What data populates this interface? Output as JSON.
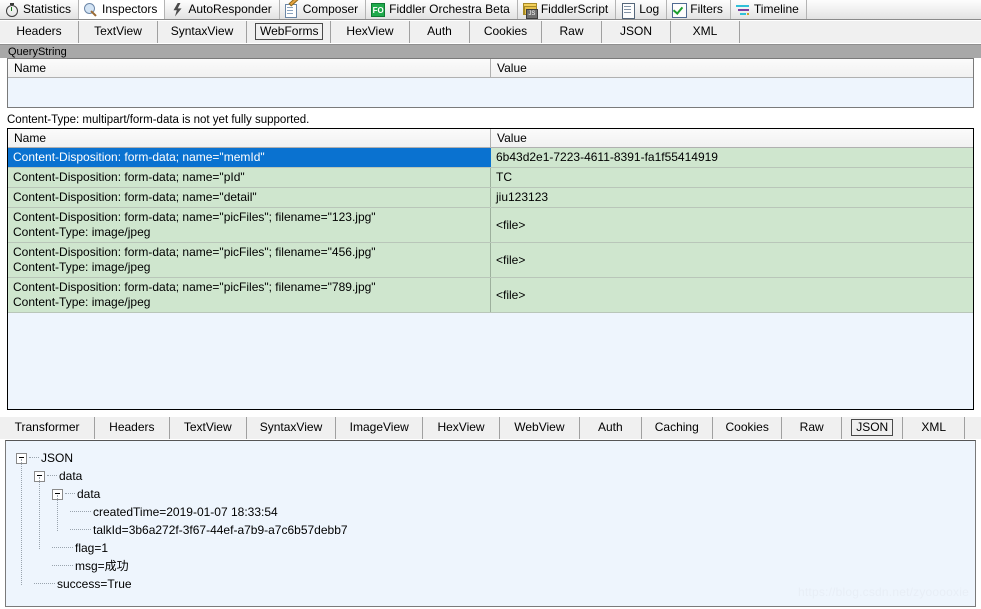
{
  "main_tabs": [
    {
      "label": "Statistics",
      "icon": "stopwatch-icon",
      "active": false
    },
    {
      "label": "Inspectors",
      "icon": "magnifier-icon",
      "active": true
    },
    {
      "label": "AutoResponder",
      "icon": "lightning-bolt-icon",
      "active": false
    },
    {
      "label": "Composer",
      "icon": "composer-pencil-icon",
      "active": false
    },
    {
      "label": "Fiddler Orchestra Beta",
      "icon": "fiddler-orchestra-badge-icon",
      "active": false
    },
    {
      "label": "FiddlerScript",
      "icon": "script-stack-icon",
      "active": false
    },
    {
      "label": "Log",
      "icon": "log-document-icon",
      "active": false
    },
    {
      "label": "Filters",
      "icon": "checkbox-check-icon",
      "active": false
    },
    {
      "label": "Timeline",
      "icon": "timeline-bars-icon",
      "active": false
    }
  ],
  "request_tabs": [
    {
      "label": "Headers",
      "selected": false,
      "width": 79
    },
    {
      "label": "TextView",
      "selected": false,
      "width": 79
    },
    {
      "label": "SyntaxView",
      "selected": false,
      "width": 89
    },
    {
      "label": "WebForms",
      "selected": true,
      "width": 84
    },
    {
      "label": "HexView",
      "selected": false,
      "width": 79
    },
    {
      "label": "Auth",
      "selected": false,
      "width": 60
    },
    {
      "label": "Cookies",
      "selected": false,
      "width": 72
    },
    {
      "label": "Raw",
      "selected": false,
      "width": 60
    },
    {
      "label": "JSON",
      "selected": false,
      "width": 69
    },
    {
      "label": "XML",
      "selected": false,
      "width": 69
    }
  ],
  "response_tabs": [
    {
      "label": "Transformer",
      "selected": false,
      "width": 96
    },
    {
      "label": "Headers",
      "selected": false,
      "width": 75
    },
    {
      "label": "TextView",
      "selected": false,
      "width": 78
    },
    {
      "label": "SyntaxView",
      "selected": false,
      "width": 90
    },
    {
      "label": "ImageView",
      "selected": false,
      "width": 88
    },
    {
      "label": "HexView",
      "selected": false,
      "width": 77
    },
    {
      "label": "WebView",
      "selected": false,
      "width": 81
    },
    {
      "label": "Auth",
      "selected": false,
      "width": 62
    },
    {
      "label": "Caching",
      "selected": false,
      "width": 72
    },
    {
      "label": "Cookies",
      "selected": false,
      "width": 70
    },
    {
      "label": "Raw",
      "selected": false,
      "width": 60
    },
    {
      "label": "JSON",
      "selected": true,
      "width": 62
    },
    {
      "label": "XML",
      "selected": false,
      "width": 62
    }
  ],
  "querystring": {
    "caption": "QueryString",
    "columns": {
      "name": "Name",
      "value": "Value"
    },
    "rows": []
  },
  "notice": "Content-Type: multipart/form-data is not yet fully supported.",
  "formdata": {
    "columns": {
      "name": "Name",
      "value": "Value"
    },
    "rows": [
      {
        "name": "Content-Disposition: form-data; name=\"memId\"",
        "value": "6b43d2e1-7223-4611-8391-fa1f55414919",
        "selected": true,
        "twoline": false
      },
      {
        "name": "Content-Disposition: form-data; name=\"pId\"",
        "value": "TC",
        "selected": false,
        "twoline": false
      },
      {
        "name": "Content-Disposition: form-data; name=\"detail\"",
        "value": "jiu123123",
        "selected": false,
        "twoline": false
      },
      {
        "name": "Content-Disposition: form-data; name=\"picFiles\"; filename=\"123.jpg\"\nContent-Type: image/jpeg",
        "value": "<file>",
        "selected": false,
        "twoline": true
      },
      {
        "name": "Content-Disposition: form-data; name=\"picFiles\"; filename=\"456.jpg\"\nContent-Type: image/jpeg",
        "value": "<file>",
        "selected": false,
        "twoline": true
      },
      {
        "name": "Content-Disposition: form-data; name=\"picFiles\"; filename=\"789.jpg\"\nContent-Type: image/jpeg",
        "value": "<file>",
        "selected": false,
        "twoline": true
      }
    ]
  },
  "json_tree": {
    "root": "JSON",
    "nodes": [
      {
        "label": "JSON",
        "depth": 0,
        "expandable": true
      },
      {
        "label": "data",
        "depth": 1,
        "expandable": true
      },
      {
        "label": "data",
        "depth": 2,
        "expandable": true
      },
      {
        "label": "createdTime=2019-01-07 18:33:54",
        "depth": 3,
        "expandable": false
      },
      {
        "label": "talkId=3b6a272f-3f67-44ef-a7b9-a7c6b57debb7",
        "depth": 3,
        "expandable": false
      },
      {
        "label": "flag=1",
        "depth": 2,
        "expandable": false
      },
      {
        "label": "msg=成功",
        "depth": 2,
        "expandable": false
      },
      {
        "label": "success=True",
        "depth": 1,
        "expandable": false
      }
    ]
  },
  "watermark": "https://blog.csdn.net/zyooooxie",
  "colors": {
    "selected_row": "#0a72d0",
    "formdata_row": "#cfe6ce",
    "panel_background": "#eef5fd",
    "tabstrip_background": "#a8a8a8"
  }
}
